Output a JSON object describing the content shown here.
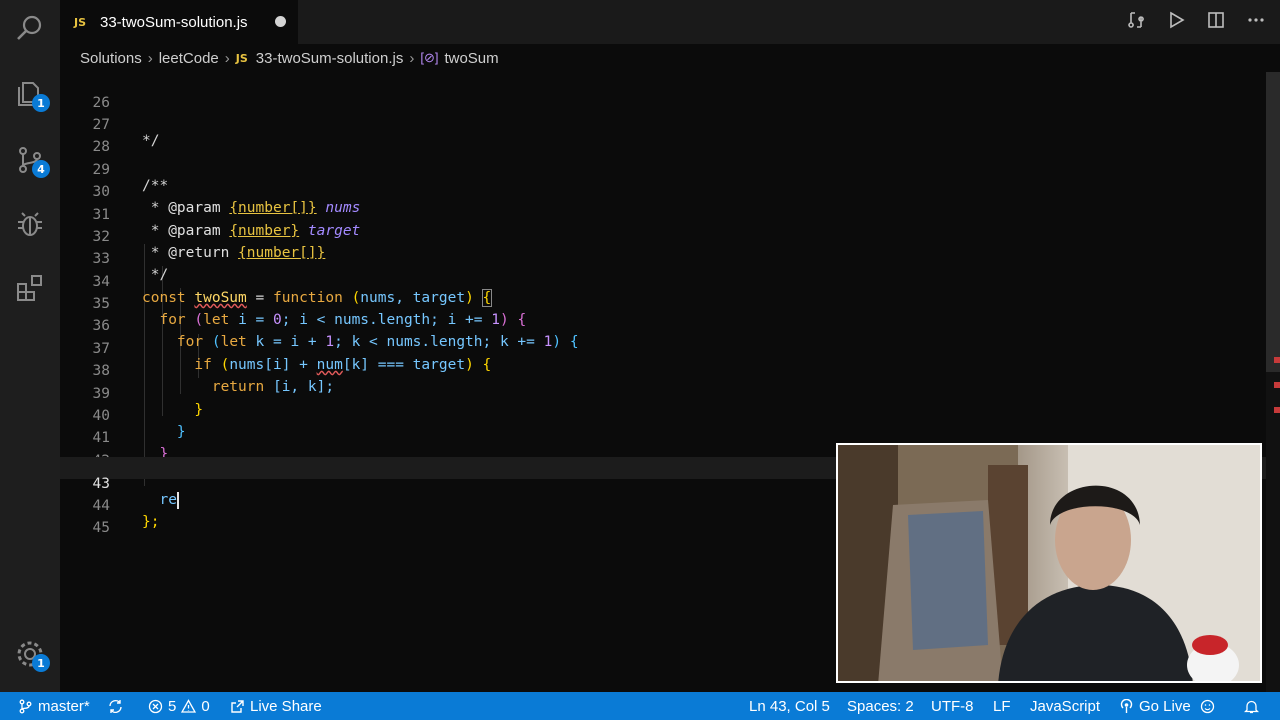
{
  "tab": {
    "title": "33-twoSum-solution.js",
    "js_label": "JS"
  },
  "breadcrumb": {
    "items": [
      "Solutions",
      "leetCode",
      "33-twoSum-solution.js",
      "twoSum"
    ]
  },
  "activity": {
    "explorer_badge": "1",
    "scm_badge": "4",
    "settings_badge": "1"
  },
  "editor": {
    "lines": [
      {
        "n": "26"
      },
      {
        "n": "27"
      },
      {
        "n": "28"
      },
      {
        "n": "29"
      },
      {
        "n": "30"
      },
      {
        "n": "31"
      },
      {
        "n": "32"
      },
      {
        "n": "33"
      },
      {
        "n": "34"
      },
      {
        "n": "35"
      },
      {
        "n": "36"
      },
      {
        "n": "37"
      },
      {
        "n": "38"
      },
      {
        "n": "39"
      },
      {
        "n": "40"
      },
      {
        "n": "41"
      },
      {
        "n": "42"
      },
      {
        "n": "43"
      },
      {
        "n": "44"
      },
      {
        "n": "45"
      }
    ],
    "code": {
      "l27": "*/",
      "l29": "/**",
      "l30_star": " * ",
      "l30_tag": "@param",
      "l30_type": "{number[]}",
      "l30_name": "nums",
      "l31_star": " * ",
      "l31_tag": "@param",
      "l31_type": "{number}",
      "l31_name": "target",
      "l32_star": " * ",
      "l32_tag": "@return",
      "l32_type": "{number[]}",
      "l33": " */",
      "l34_const": "const",
      "l34_name": "twoSum",
      "l34_eq": " = ",
      "l34_fn": "function",
      "l34_params": "nums, target",
      "l35_for": "for",
      "l35_let": "let",
      "l35_body_a": " i = ",
      "l35_zero": "0",
      "l35_body_b": "; i < nums.length; i += ",
      "l35_one": "1",
      "l36_for": "for",
      "l36_let": "let",
      "l36_body_a": " k = i + ",
      "l36_one_a": "1",
      "l36_body_b": "; k < nums.length; k += ",
      "l36_one_b": "1",
      "l37_if": "if",
      "l37_a": "nums[i] + ",
      "l37_num": "num",
      "l37_b": "[k] === target",
      "l38_return": "return",
      "l38_val": " [i, k];",
      "l39": "}",
      "l40": "}",
      "l41": "}",
      "l43": "re",
      "l44": "};"
    }
  },
  "status": {
    "branch": "master*",
    "errors": "5",
    "warnings": "0",
    "live_share": "Live Share",
    "position": "Ln 43, Col 5",
    "spaces": "Spaces: 2",
    "encoding": "UTF-8",
    "eol": "LF",
    "language": "JavaScript",
    "go_live": "Go Live"
  },
  "colors": {
    "status_bar": "#0a7bd6",
    "editor_bg": "#0b0b0b",
    "keyword": "#e8a941",
    "identifier": "#76c7ff",
    "function_name": "#ffd866"
  }
}
